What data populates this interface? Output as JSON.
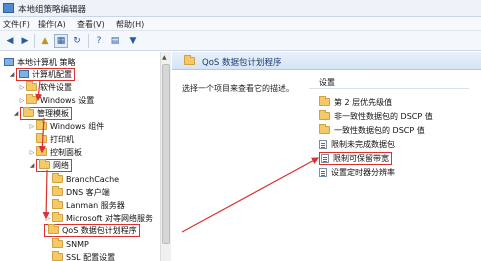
{
  "window": {
    "title": "本地组策略编辑器"
  },
  "menu": [
    "文件(F)",
    "操作(A)",
    "查看(V)",
    "帮助(H)"
  ],
  "toolbar": [
    "back-icon",
    "forward-icon",
    "up-folder-icon",
    "show-hide-tree-icon",
    "refresh-icon",
    "help-icon",
    "properties-icon",
    "filter-icon"
  ],
  "tree": {
    "root": "本地计算机 策略",
    "computer_config": "计算机配置",
    "software_settings": "软件设置",
    "windows_settings": "Windows 设置",
    "admin_templates": "管理模板",
    "windows_components": "Windows 组件",
    "printers": "打印机",
    "control_panel": "控制面板",
    "network": "网络",
    "branchcache": "BranchCache",
    "dns_client": "DNS 客户端",
    "lanman_server": "Lanman 服务器",
    "ms_peer_network": "Microsoft 对等网络服务",
    "qos": "QoS 数据包计划程序",
    "snmp": "SNMP",
    "ssl": "SSL 配置设置"
  },
  "right": {
    "header": "QoS 数据包计划程序",
    "description": "选择一个项目来查看它的描述。",
    "settings_header": "设置",
    "items": [
      {
        "label": "第 2 层优先级值",
        "type": "folder"
      },
      {
        "label": "非一致性数据包的 DSCP 值",
        "type": "folder"
      },
      {
        "label": "一致性数据包的 DSCP 值",
        "type": "folder"
      },
      {
        "label": "限制未完成数据包",
        "type": "setting"
      },
      {
        "label": "限制可保留带宽",
        "type": "setting"
      },
      {
        "label": "设置定时器分辨率",
        "type": "setting"
      }
    ]
  },
  "colors": {
    "highlight": "#d93030",
    "folder": "#f4c967",
    "header": "#d5e4f5"
  }
}
